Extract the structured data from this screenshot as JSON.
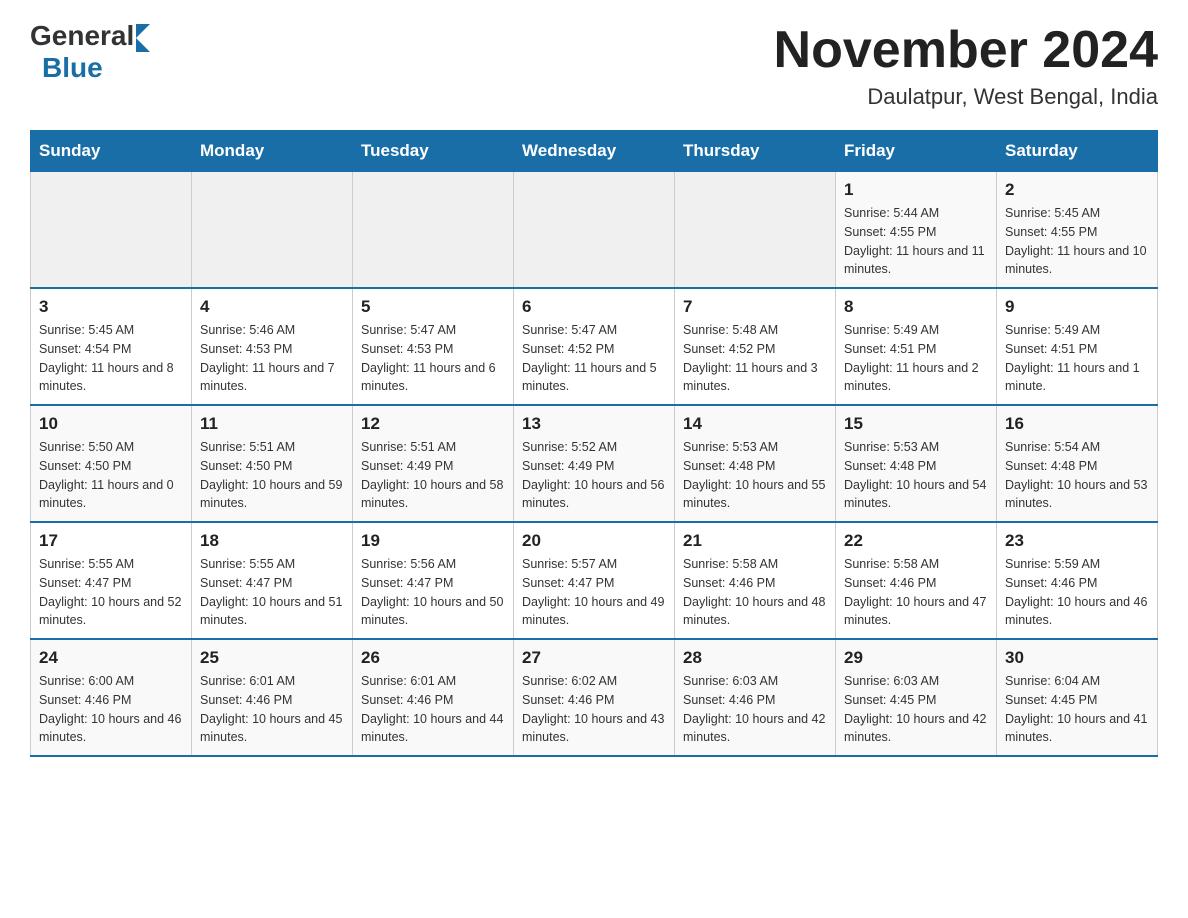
{
  "logo": {
    "general": "General",
    "blue": "Blue"
  },
  "title": "November 2024",
  "subtitle": "Daulatpur, West Bengal, India",
  "days_of_week": [
    "Sunday",
    "Monday",
    "Tuesday",
    "Wednesday",
    "Thursday",
    "Friday",
    "Saturday"
  ],
  "weeks": [
    [
      {
        "day": "",
        "info": ""
      },
      {
        "day": "",
        "info": ""
      },
      {
        "day": "",
        "info": ""
      },
      {
        "day": "",
        "info": ""
      },
      {
        "day": "",
        "info": ""
      },
      {
        "day": "1",
        "info": "Sunrise: 5:44 AM\nSunset: 4:55 PM\nDaylight: 11 hours and 11 minutes."
      },
      {
        "day": "2",
        "info": "Sunrise: 5:45 AM\nSunset: 4:55 PM\nDaylight: 11 hours and 10 minutes."
      }
    ],
    [
      {
        "day": "3",
        "info": "Sunrise: 5:45 AM\nSunset: 4:54 PM\nDaylight: 11 hours and 8 minutes."
      },
      {
        "day": "4",
        "info": "Sunrise: 5:46 AM\nSunset: 4:53 PM\nDaylight: 11 hours and 7 minutes."
      },
      {
        "day": "5",
        "info": "Sunrise: 5:47 AM\nSunset: 4:53 PM\nDaylight: 11 hours and 6 minutes."
      },
      {
        "day": "6",
        "info": "Sunrise: 5:47 AM\nSunset: 4:52 PM\nDaylight: 11 hours and 5 minutes."
      },
      {
        "day": "7",
        "info": "Sunrise: 5:48 AM\nSunset: 4:52 PM\nDaylight: 11 hours and 3 minutes."
      },
      {
        "day": "8",
        "info": "Sunrise: 5:49 AM\nSunset: 4:51 PM\nDaylight: 11 hours and 2 minutes."
      },
      {
        "day": "9",
        "info": "Sunrise: 5:49 AM\nSunset: 4:51 PM\nDaylight: 11 hours and 1 minute."
      }
    ],
    [
      {
        "day": "10",
        "info": "Sunrise: 5:50 AM\nSunset: 4:50 PM\nDaylight: 11 hours and 0 minutes."
      },
      {
        "day": "11",
        "info": "Sunrise: 5:51 AM\nSunset: 4:50 PM\nDaylight: 10 hours and 59 minutes."
      },
      {
        "day": "12",
        "info": "Sunrise: 5:51 AM\nSunset: 4:49 PM\nDaylight: 10 hours and 58 minutes."
      },
      {
        "day": "13",
        "info": "Sunrise: 5:52 AM\nSunset: 4:49 PM\nDaylight: 10 hours and 56 minutes."
      },
      {
        "day": "14",
        "info": "Sunrise: 5:53 AM\nSunset: 4:48 PM\nDaylight: 10 hours and 55 minutes."
      },
      {
        "day": "15",
        "info": "Sunrise: 5:53 AM\nSunset: 4:48 PM\nDaylight: 10 hours and 54 minutes."
      },
      {
        "day": "16",
        "info": "Sunrise: 5:54 AM\nSunset: 4:48 PM\nDaylight: 10 hours and 53 minutes."
      }
    ],
    [
      {
        "day": "17",
        "info": "Sunrise: 5:55 AM\nSunset: 4:47 PM\nDaylight: 10 hours and 52 minutes."
      },
      {
        "day": "18",
        "info": "Sunrise: 5:55 AM\nSunset: 4:47 PM\nDaylight: 10 hours and 51 minutes."
      },
      {
        "day": "19",
        "info": "Sunrise: 5:56 AM\nSunset: 4:47 PM\nDaylight: 10 hours and 50 minutes."
      },
      {
        "day": "20",
        "info": "Sunrise: 5:57 AM\nSunset: 4:47 PM\nDaylight: 10 hours and 49 minutes."
      },
      {
        "day": "21",
        "info": "Sunrise: 5:58 AM\nSunset: 4:46 PM\nDaylight: 10 hours and 48 minutes."
      },
      {
        "day": "22",
        "info": "Sunrise: 5:58 AM\nSunset: 4:46 PM\nDaylight: 10 hours and 47 minutes."
      },
      {
        "day": "23",
        "info": "Sunrise: 5:59 AM\nSunset: 4:46 PM\nDaylight: 10 hours and 46 minutes."
      }
    ],
    [
      {
        "day": "24",
        "info": "Sunrise: 6:00 AM\nSunset: 4:46 PM\nDaylight: 10 hours and 46 minutes."
      },
      {
        "day": "25",
        "info": "Sunrise: 6:01 AM\nSunset: 4:46 PM\nDaylight: 10 hours and 45 minutes."
      },
      {
        "day": "26",
        "info": "Sunrise: 6:01 AM\nSunset: 4:46 PM\nDaylight: 10 hours and 44 minutes."
      },
      {
        "day": "27",
        "info": "Sunrise: 6:02 AM\nSunset: 4:46 PM\nDaylight: 10 hours and 43 minutes."
      },
      {
        "day": "28",
        "info": "Sunrise: 6:03 AM\nSunset: 4:46 PM\nDaylight: 10 hours and 42 minutes."
      },
      {
        "day": "29",
        "info": "Sunrise: 6:03 AM\nSunset: 4:45 PM\nDaylight: 10 hours and 42 minutes."
      },
      {
        "day": "30",
        "info": "Sunrise: 6:04 AM\nSunset: 4:45 PM\nDaylight: 10 hours and 41 minutes."
      }
    ]
  ]
}
